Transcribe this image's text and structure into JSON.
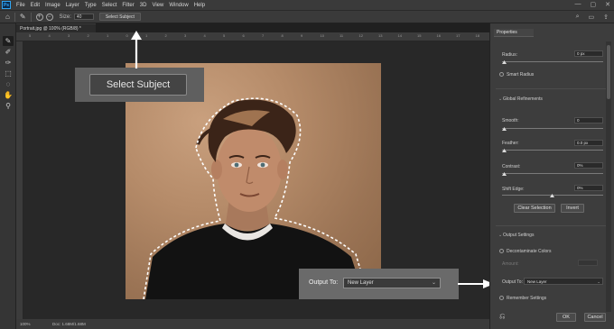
{
  "menubar": {
    "logo": "Ps",
    "items": [
      "File",
      "Edit",
      "Image",
      "Layer",
      "Type",
      "Select",
      "Filter",
      "3D",
      "View",
      "Window",
      "Help"
    ],
    "window_controls": [
      "—",
      "▢",
      "✕"
    ]
  },
  "options_bar": {
    "size_label": "Size:",
    "size_value": "40",
    "select_subject_label": "Select Subject"
  },
  "document": {
    "tab_title": "Portrait.jpg @ 100% (RGB/8) *",
    "zoom": "100%",
    "doc_info": "Doc: 1.68M/1.68M",
    "ruler_ticks": [
      "5",
      "4",
      "3",
      "2",
      "1",
      "0",
      "1",
      "2",
      "3",
      "4",
      "5",
      "6",
      "7",
      "8",
      "9",
      "10",
      "11",
      "12",
      "13",
      "14",
      "15",
      "16",
      "17",
      "18"
    ]
  },
  "callouts": {
    "select_subject": "Select Subject",
    "output_label": "Output To:",
    "output_value": "New Layer"
  },
  "properties": {
    "tab": "Properties",
    "radius_label": "Radius:",
    "radius_value": "0 px",
    "smart_radius": "Smart Radius",
    "global_refinements": "Global Refinements",
    "smooth_label": "Smooth:",
    "smooth_value": "0",
    "feather_label": "Feather:",
    "feather_value": "0.0 px",
    "contrast_label": "Contrast:",
    "contrast_value": "0%",
    "shift_edge_label": "Shift Edge:",
    "shift_edge_value": "0%",
    "clear_selection": "Clear Selection",
    "invert": "Invert",
    "output_settings": "Output Settings",
    "decontaminate": "Decontaminate Colors",
    "amount_label": "Amount:",
    "output_to_label": "Output To:",
    "output_to_value": "New Layer",
    "remember_settings": "Remember Settings",
    "ok": "OK",
    "cancel": "Cancel"
  },
  "colors": {
    "accent_arrow": "#ffffff",
    "panel_bg": "#3d3d3d",
    "canvas_bg": "#282828"
  }
}
